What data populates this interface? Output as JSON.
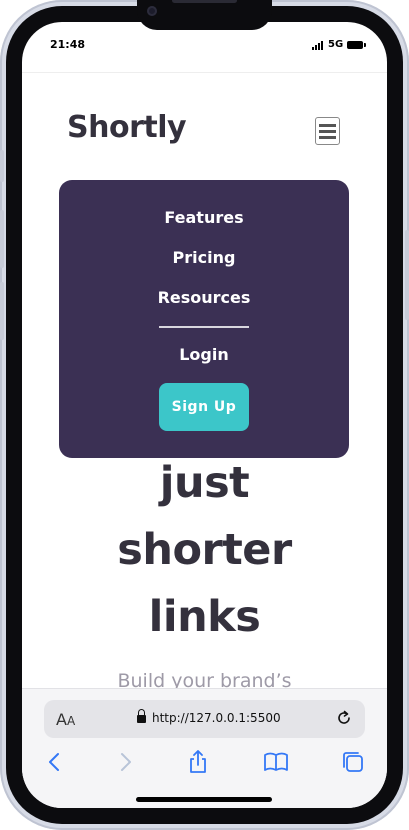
{
  "status_bar": {
    "time": "21:48",
    "network": "5G"
  },
  "header": {
    "logo": "Shortly"
  },
  "menu": {
    "items": [
      "Features",
      "Pricing",
      "Resources"
    ],
    "login": "Login",
    "signup": "Sign Up"
  },
  "hero": {
    "lines": [
      "just",
      "shorter",
      "links"
    ],
    "subtitle": "Build your brand’s"
  },
  "browser": {
    "text_size_label": "AA",
    "url": "http://127.0.0.1:5500"
  },
  "colors": {
    "menu_bg": "#3b3054",
    "accent": "#3cc6c9",
    "text_dark": "#34313d"
  },
  "icons": [
    "menu-icon",
    "lock-icon",
    "reload-icon",
    "back-icon",
    "forward-icon",
    "share-icon",
    "bookmarks-icon",
    "tabs-icon"
  ]
}
